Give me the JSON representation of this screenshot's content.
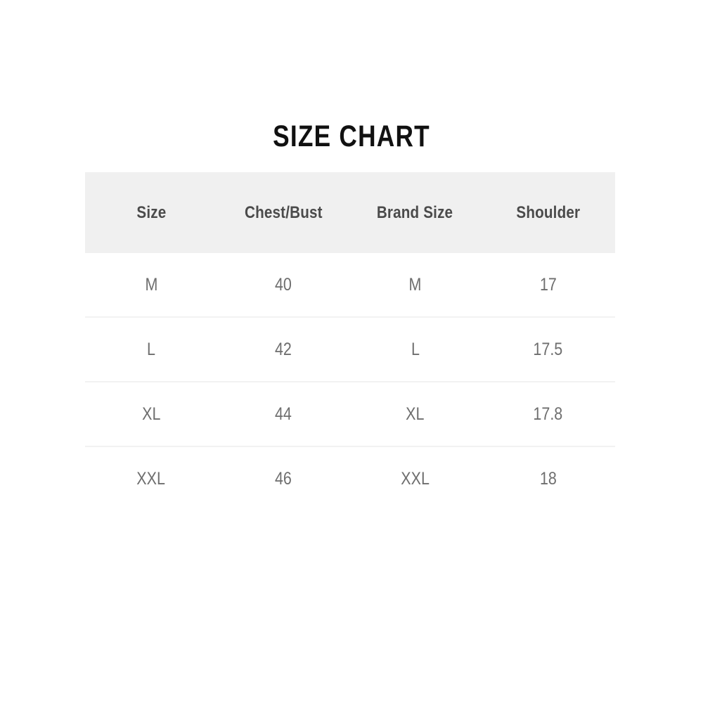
{
  "page": {
    "background_color": "#ffffff",
    "title": "SIZE CHART"
  },
  "theme": {
    "title_color": "#111111",
    "header_background": "#f0f0f0",
    "header_text_color": "#4b4b4b",
    "cell_text_color": "#6e6e6e",
    "divider_color": "#f2f2f2",
    "table_background": "#ffffff"
  },
  "table": {
    "columns": [
      {
        "key": "size",
        "label": "Size"
      },
      {
        "key": "chest_bust",
        "label": "Chest/Bust"
      },
      {
        "key": "brand_size",
        "label": "Brand Size"
      },
      {
        "key": "shoulder",
        "label": "Shoulder"
      }
    ],
    "rows": [
      {
        "size": "M",
        "chest_bust": "40",
        "brand_size": "M",
        "shoulder": "17"
      },
      {
        "size": "L",
        "chest_bust": "42",
        "brand_size": "L",
        "shoulder": "17.5"
      },
      {
        "size": "XL",
        "chest_bust": "44",
        "brand_size": "XL",
        "shoulder": "17.8"
      },
      {
        "size": "XXL",
        "chest_bust": "46",
        "brand_size": "XXL",
        "shoulder": "18"
      }
    ]
  },
  "chart_data": {
    "type": "table",
    "title": "SIZE CHART",
    "columns": [
      "Size",
      "Chest/Bust",
      "Brand Size",
      "Shoulder"
    ],
    "rows": [
      [
        "M",
        "40",
        "M",
        "17"
      ],
      [
        "L",
        "42",
        "L",
        "17.5"
      ],
      [
        "XL",
        "44",
        "XL",
        "17.8"
      ],
      [
        "XXL",
        "46",
        "XXL",
        "18"
      ]
    ],
    "xlabel": "",
    "ylabel": "",
    "grid": false,
    "legend": "none"
  }
}
